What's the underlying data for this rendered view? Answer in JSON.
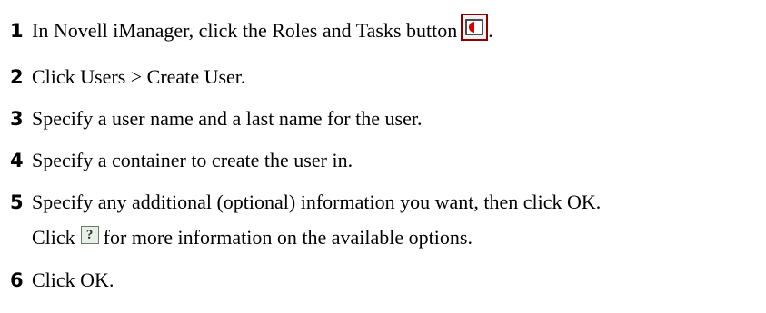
{
  "steps": [
    {
      "number": "1",
      "text": "In Novell iManager, click the Roles and Tasks button",
      "suffix": "."
    },
    {
      "number": "2",
      "text": "Click Users > Create User."
    },
    {
      "number": "3",
      "text": "Specify a user name and a last name for the user."
    },
    {
      "number": "4",
      "text": "Specify a container to create the user in."
    },
    {
      "number": "5",
      "text": "Specify any additional (optional) information you want, then click OK."
    },
    {
      "number": "6",
      "text": "Click OK."
    }
  ],
  "step5_continuation": {
    "before": "Click",
    "help_glyph": "?",
    "after": "for more information on the available options."
  },
  "icons": {
    "roles_and_tasks": "roles-and-tasks-icon",
    "help": "help-icon"
  },
  "colors": {
    "text": "#000000",
    "roles_icon_border": "#8a0000",
    "roles_icon_accent": "#d40000"
  }
}
